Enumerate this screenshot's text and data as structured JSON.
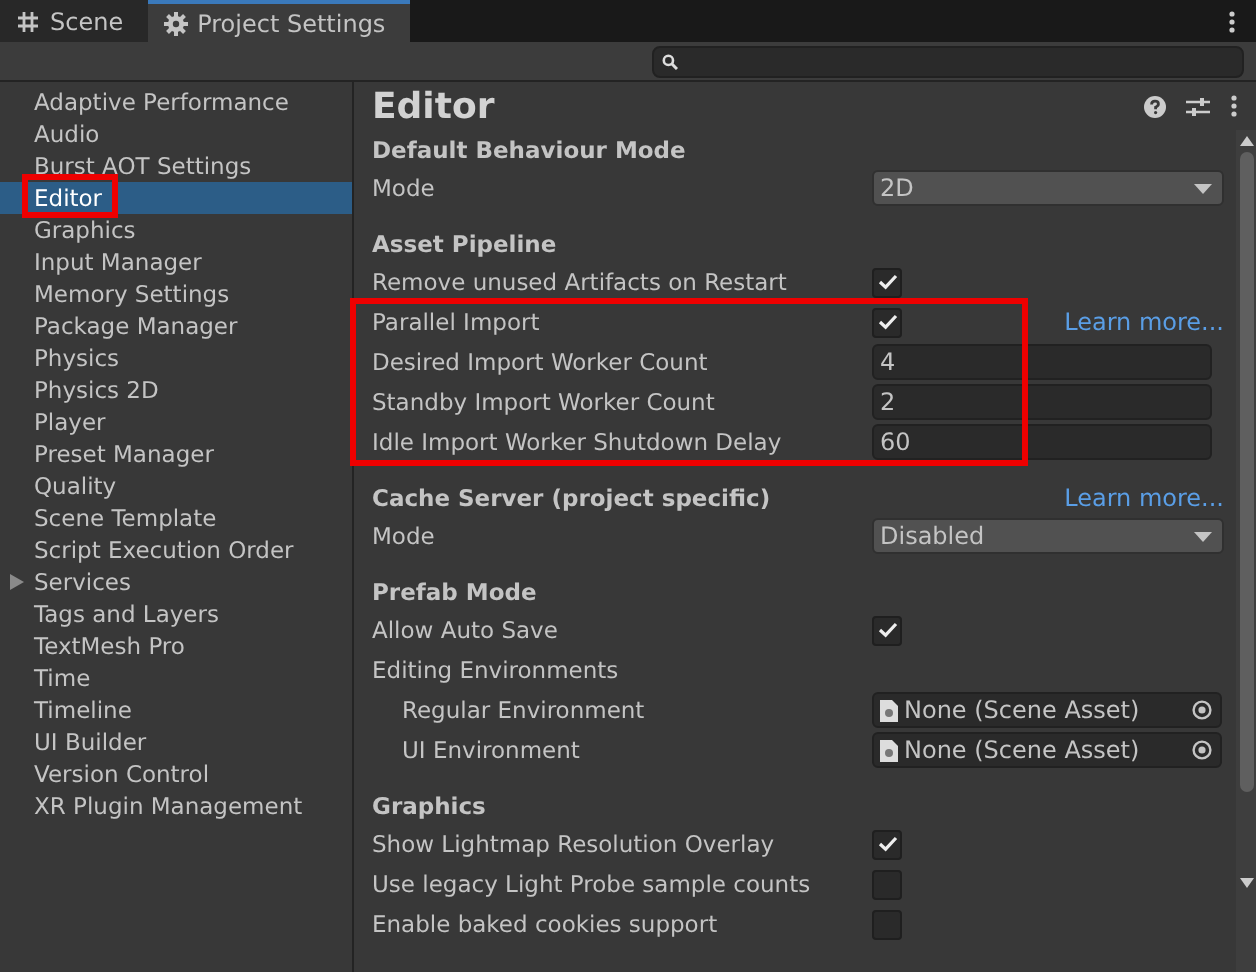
{
  "tabs": [
    {
      "label": "Scene",
      "selected": false
    },
    {
      "label": "Project Settings",
      "selected": true
    }
  ],
  "sidebar": {
    "items": [
      {
        "label": "Adaptive Performance",
        "selected": false,
        "highlighted": false
      },
      {
        "label": "Audio",
        "selected": false,
        "highlighted": false
      },
      {
        "label": "Burst AOT Settings",
        "selected": false,
        "highlighted": false
      },
      {
        "label": "Editor",
        "selected": true,
        "highlighted": true
      },
      {
        "label": "Graphics",
        "selected": false,
        "highlighted": false
      },
      {
        "label": "Input Manager",
        "selected": false,
        "highlighted": false
      },
      {
        "label": "Memory Settings",
        "selected": false,
        "highlighted": false
      },
      {
        "label": "Package Manager",
        "selected": false,
        "highlighted": false
      },
      {
        "label": "Physics",
        "selected": false,
        "highlighted": false
      },
      {
        "label": "Physics 2D",
        "selected": false,
        "highlighted": false
      },
      {
        "label": "Player",
        "selected": false,
        "highlighted": false
      },
      {
        "label": "Preset Manager",
        "selected": false,
        "highlighted": false
      },
      {
        "label": "Quality",
        "selected": false,
        "highlighted": false
      },
      {
        "label": "Scene Template",
        "selected": false,
        "highlighted": false
      },
      {
        "label": "Script Execution Order",
        "selected": false,
        "highlighted": false
      },
      {
        "label": "Services",
        "selected": false,
        "highlighted": false,
        "expandable": true
      },
      {
        "label": "Tags and Layers",
        "selected": false,
        "highlighted": false
      },
      {
        "label": "TextMesh Pro",
        "selected": false,
        "highlighted": false
      },
      {
        "label": "Time",
        "selected": false,
        "highlighted": false
      },
      {
        "label": "Timeline",
        "selected": false,
        "highlighted": false
      },
      {
        "label": "UI Builder",
        "selected": false,
        "highlighted": false
      },
      {
        "label": "Version Control",
        "selected": false,
        "highlighted": false
      },
      {
        "label": "XR Plugin Management",
        "selected": false,
        "highlighted": false
      }
    ]
  },
  "panel": {
    "title": "Editor",
    "sections": [
      {
        "title": "Default Behaviour Mode",
        "rows": [
          {
            "kind": "dropdown",
            "label": "Mode",
            "value": "2D"
          }
        ]
      },
      {
        "title": "Asset Pipeline",
        "rows": [
          {
            "kind": "checkbox",
            "label": "Remove unused Artifacts on Restart",
            "checked": true
          },
          {
            "kind": "group",
            "highlighted": true,
            "rows": [
              {
                "kind": "checkbox",
                "label": "Parallel Import",
                "checked": true,
                "link": "Learn more..."
              },
              {
                "kind": "number",
                "label": "Desired Import Worker Count",
                "value": "4"
              },
              {
                "kind": "number",
                "label": "Standby Import Worker Count",
                "value": "2"
              },
              {
                "kind": "number",
                "label": "Idle Import Worker Shutdown Delay",
                "value": "60"
              }
            ]
          }
        ]
      },
      {
        "title": "Cache Server (project specific)",
        "link": "Learn more...",
        "rows": [
          {
            "kind": "dropdown",
            "label": "Mode",
            "value": "Disabled"
          }
        ]
      },
      {
        "title": "Prefab Mode",
        "rows": [
          {
            "kind": "checkbox",
            "label": "Allow Auto Save",
            "checked": true
          },
          {
            "kind": "label",
            "label": "Editing Environments"
          },
          {
            "kind": "object",
            "label": "Regular Environment",
            "value": "None (Scene Asset)",
            "indent": true
          },
          {
            "kind": "object",
            "label": "UI Environment",
            "value": "None (Scene Asset)",
            "indent": true
          }
        ]
      },
      {
        "title": "Graphics",
        "rows": [
          {
            "kind": "checkbox",
            "label": "Show Lightmap Resolution Overlay",
            "checked": true
          },
          {
            "kind": "checkbox",
            "label": "Use legacy Light Probe sample counts",
            "checked": false
          },
          {
            "kind": "checkbox",
            "label": "Enable baked cookies support",
            "checked": false
          }
        ]
      }
    ]
  }
}
